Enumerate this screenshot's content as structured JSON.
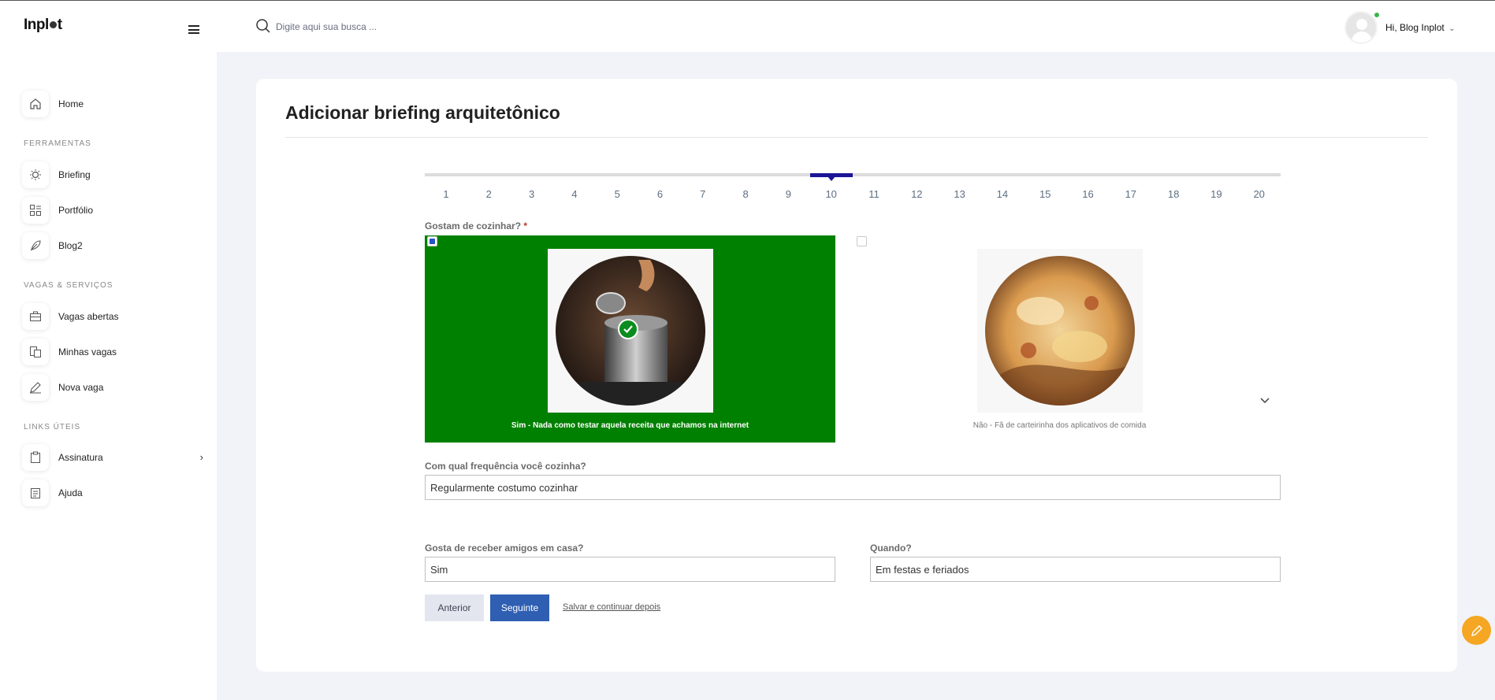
{
  "brand": {
    "logo_text_left": "Inpl",
    "logo_text_right": "t"
  },
  "search": {
    "placeholder": "Digite aqui sua busca ..."
  },
  "user": {
    "greeting": "Hi,",
    "name": "Blog Inplot"
  },
  "sidebar": {
    "home": "Home",
    "section_tools": "FERRAMENTAS",
    "briefing": "Briefing",
    "portfolio": "Portfólio",
    "blog": "Blog2",
    "section_jobs": "VAGAS & SERVIÇOS",
    "open_jobs": "Vagas abertas",
    "my_jobs": "Minhas vagas",
    "new_job": "Nova vaga",
    "section_links": "LINKS ÚTEIS",
    "subscription": "Assinatura",
    "help": "Ajuda"
  },
  "page": {
    "title": "Adicionar briefing arquitetônico"
  },
  "steps": {
    "active": "10",
    "labels": [
      "1",
      "2",
      "3",
      "4",
      "5",
      "6",
      "7",
      "8",
      "9",
      "10",
      "11",
      "12",
      "13",
      "14",
      "15",
      "16",
      "17",
      "18",
      "19",
      "20"
    ]
  },
  "form": {
    "q_cooking": "Gostam de cozinhar?",
    "required_mark": "*",
    "option_yes": {
      "caption": "Sim - Nada como testar aquela receita que achamos na internet",
      "selected": true,
      "icon": "cooking-pot-photo"
    },
    "option_no": {
      "caption": "Não - Fã de carteirinha dos aplicativos de comida",
      "selected": false,
      "icon": "pizza-photo"
    },
    "q_frequency": "Com qual frequência você cozinha?",
    "frequency_value": "Regularmente costumo cozinhar",
    "q_friends": "Gosta de receber amigos em casa?",
    "friends_value": "Sim",
    "q_when": "Quando?",
    "when_value": "Em festas e feriados"
  },
  "actions": {
    "prev": "Anterior",
    "next": "Seguinte",
    "save_later": "Salvar e continuar depois"
  },
  "colors": {
    "selected_bg": "#008000",
    "primary": "#2f5fb3",
    "step_active": "#1a1696",
    "fab": "#f5a623"
  }
}
